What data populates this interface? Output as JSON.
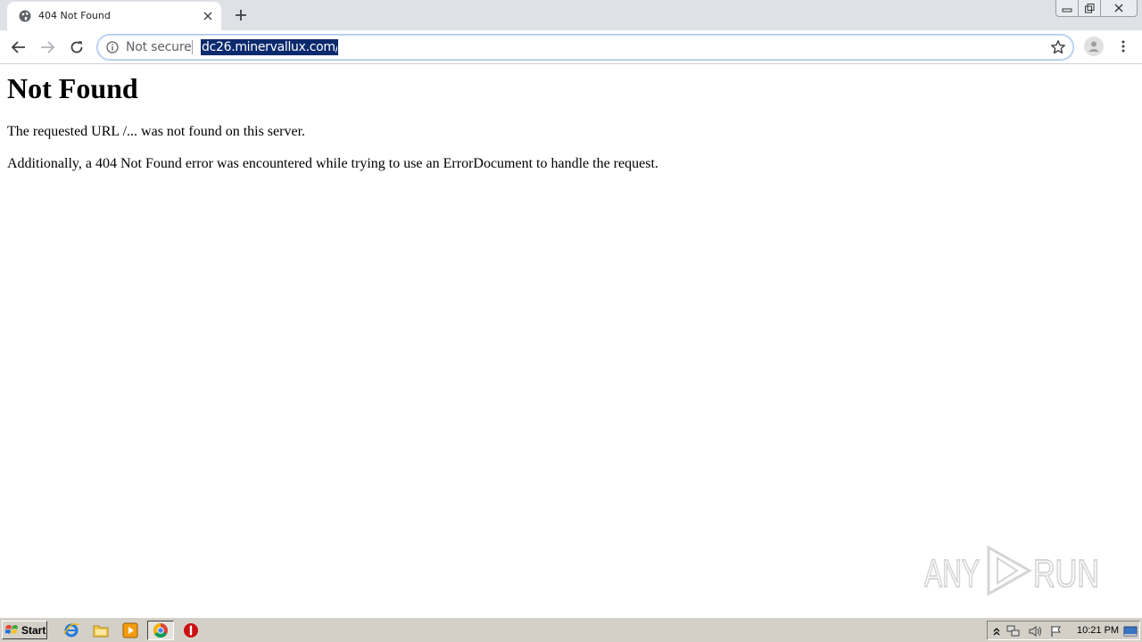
{
  "browser": {
    "tab": {
      "title": "404 Not Found"
    },
    "omnibox": {
      "security_label": "Not secure",
      "url": "dc26.minervallux.com/..."
    }
  },
  "page": {
    "heading": "Not Found",
    "paragraphs": [
      "The requested URL /... was not found on this server.",
      "Additionally, a 404 Not Found error was encountered while trying to use an ErrorDocument to handle the request."
    ]
  },
  "watermark": {
    "text": "ANY RUN"
  },
  "taskbar": {
    "start_label": "Start",
    "clock": "10:21 PM"
  },
  "colors": {
    "url_highlight": "#0b2a6e",
    "tabstrip": "#dee1e6",
    "taskbar": "#d4d0c8"
  }
}
